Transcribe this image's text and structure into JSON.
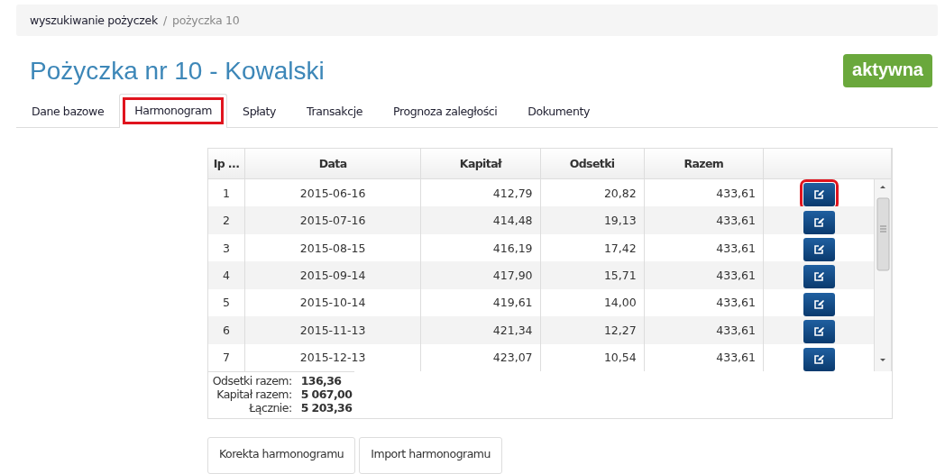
{
  "breadcrumb": [
    {
      "label": "wyszukiwanie pożyczek",
      "link": true
    },
    {
      "label": "pożyczka 10",
      "link": false
    }
  ],
  "breadcrumb_separator": "/",
  "title": "Pożyczka nr 10 - Kowalski",
  "status_badge": "aktywna",
  "tabs": [
    {
      "label": "Dane bazowe",
      "selected": false,
      "highlighted": false
    },
    {
      "label": "Harmonogram",
      "selected": true,
      "highlighted": true
    },
    {
      "label": "Spłaty",
      "selected": false,
      "highlighted": false
    },
    {
      "label": "Transakcje",
      "selected": false,
      "highlighted": false
    },
    {
      "label": "Prognoza zaległości",
      "selected": false,
      "highlighted": false
    },
    {
      "label": "Dokumenty",
      "selected": false,
      "highlighted": false
    }
  ],
  "table": {
    "columns": [
      "Ip ...",
      "Data",
      "Kapitał",
      "Odsetki",
      "Razem"
    ],
    "rows": [
      {
        "cells": [
          "1",
          "2015-06-16",
          "412,79",
          "20,82",
          "433,61"
        ],
        "highlighted": true
      },
      {
        "cells": [
          "2",
          "2015-07-16",
          "414,48",
          "19,13",
          "433,61"
        ],
        "highlighted": false
      },
      {
        "cells": [
          "3",
          "2015-08-15",
          "416,19",
          "17,42",
          "433,61"
        ],
        "highlighted": false
      },
      {
        "cells": [
          "4",
          "2015-09-14",
          "417,90",
          "15,71",
          "433,61"
        ],
        "highlighted": false
      },
      {
        "cells": [
          "5",
          "2015-10-14",
          "419,61",
          "14,00",
          "433,61"
        ],
        "highlighted": false
      },
      {
        "cells": [
          "6",
          "2015-11-13",
          "421,34",
          "12,27",
          "433,61"
        ],
        "highlighted": false
      },
      {
        "cells": [
          "7",
          "2015-12-13",
          "423,07",
          "10,54",
          "433,61"
        ],
        "highlighted": false
      }
    ]
  },
  "summary": [
    {
      "label": "Odsetki razem:",
      "value": "136,36"
    },
    {
      "label": "Kapitał razem:",
      "value": "5 067,00"
    },
    {
      "label": "Łącznie:",
      "value": "5 203,36"
    }
  ],
  "buttons": [
    "Korekta harmonogramu",
    "Import harmonogramu"
  ]
}
